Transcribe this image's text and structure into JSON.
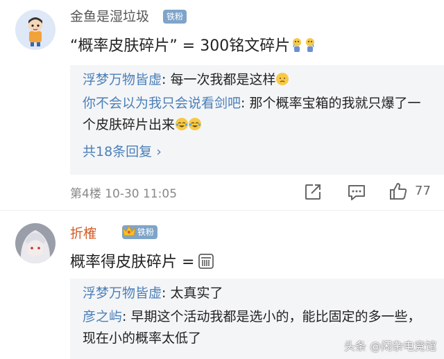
{
  "comment1": {
    "username": "金鱼是湿垃圾",
    "badge": "铁粉",
    "text": "“概率皮肤碎片” = 300铭文碎片",
    "emojis": [
      "crying-figure-emoji",
      "crying-figure-emoji"
    ],
    "replies": [
      {
        "name": "浮梦万物皆虚",
        "sep": ": ",
        "text": "每一次我都是这样",
        "emoji": "sad-face-emoji"
      },
      {
        "name": "你不会以为我只会说看剑吧",
        "sep": ": ",
        "text": "那个概率宝箱的我就只爆了一个皮肤碎片出来",
        "emoji": "laughing-crying-emoji"
      }
    ],
    "more_replies": "共18条回复 ›",
    "meta": "第4楼  10-30 11:05",
    "likes": "77"
  },
  "comment2": {
    "username": "折榷",
    "badge": "铁粉",
    "text": "概率得皮肤碎片 =",
    "emoji": "speechless-emoji",
    "replies": [
      {
        "name": "浮梦万物皆虚",
        "sep": ": ",
        "text": "太真实了"
      },
      {
        "name": "彦之屿",
        "sep": ": ",
        "text": "早期这个活动我都是选小的，能比固定的多一些，现在小的概率太低了"
      }
    ]
  },
  "watermark": "头条 @闲杂电竞馆",
  "colors": {
    "username_orange": "#d55a24",
    "reply_name_blue": "#4a7fb8",
    "badge_blue": "#7fa4c9",
    "reply_bg": "#f4f5f7"
  }
}
